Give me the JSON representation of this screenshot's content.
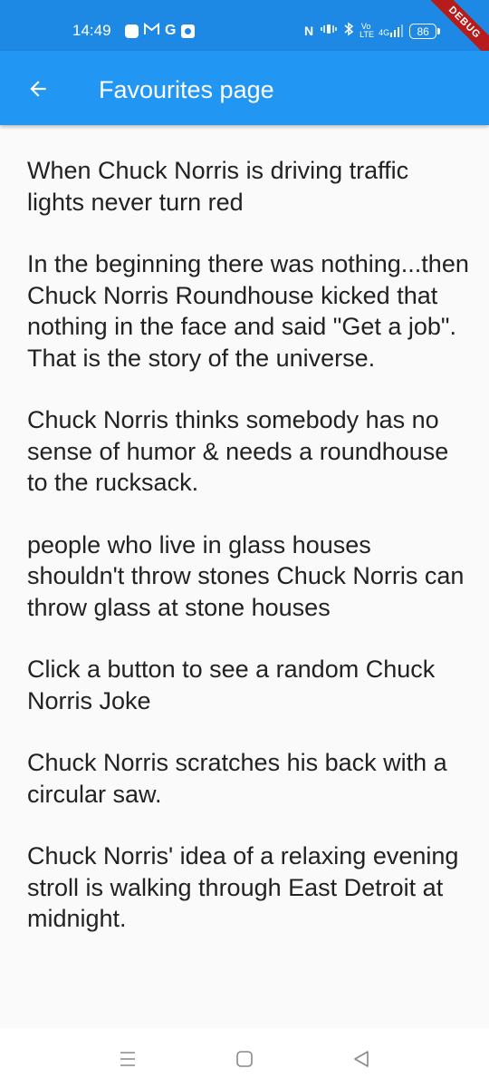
{
  "status_bar": {
    "time": "14:49",
    "left_icons": [
      "app-icon",
      "gmail-icon",
      "google-icon",
      "shield-icon"
    ],
    "right_icons": [
      "nfc-icon",
      "vibrate-icon",
      "bluetooth-icon",
      "volte-icon",
      "signal-icon"
    ],
    "volte_label": "Vo LTE",
    "network_label": "4G",
    "battery": "86",
    "debug_banner": "DEBUG"
  },
  "app_bar": {
    "title": "Favourites page",
    "back_icon": "arrow-back-icon"
  },
  "jokes": [
    "When Chuck Norris is driving traffic lights never turn red",
    "In the beginning there was nothing...then Chuck Norris Roundhouse kicked that nothing in the face and said \"Get a job\". That is the story of the universe.",
    "Chuck Norris thinks somebody has no sense of humor & needs a roundhouse to the rucksack.",
    "people who live in glass houses shouldn't throw stones Chuck Norris can throw glass at stone houses",
    "Click a button to see a random Chuck Norris Joke",
    "Chuck Norris scratches his back with a circular saw.",
    "Chuck Norris' idea of a relaxing evening stroll is walking through East Detroit at midnight."
  ],
  "nav_bar": {
    "recents": "recents-icon",
    "home": "home-icon",
    "back": "back-triangle-icon"
  },
  "colors": {
    "status_bar": "#1e88e5",
    "app_bar": "#2196f3",
    "background": "#fafafa",
    "text": "#222222"
  }
}
